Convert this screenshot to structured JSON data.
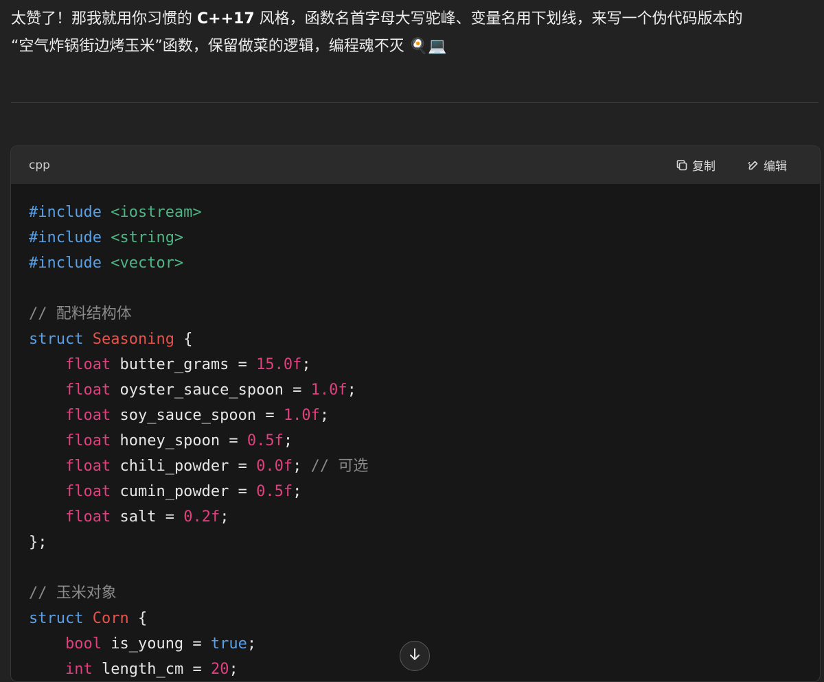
{
  "intro": {
    "line1_pre": "太赞了！那我就用你习惯的 ",
    "line1_bold": "C++17",
    "line1_post": " 风格，函数名首字母大写驼峰、变量名用下划线，来写一个伪代码版本的",
    "line2": "“空气炸锅街边烤玉米”函数，保留做菜的逻辑，编程魂不灭",
    "emoji": "🍳💻"
  },
  "code_block": {
    "language": "cpp",
    "copy_label": "复制",
    "edit_label": "编辑",
    "includes": [
      "<iostream>",
      "<string>",
      "<vector>"
    ],
    "include_kw": "include",
    "comment_seasoning": "// 配料结构体",
    "struct_kw": "struct",
    "struct_seasoning": "Seasoning",
    "seasoning_fields": [
      {
        "type": "float",
        "name": "butter_grams",
        "value": "15.0f"
      },
      {
        "type": "float",
        "name": "oyster_sauce_spoon",
        "value": "1.0f"
      },
      {
        "type": "float",
        "name": "soy_sauce_spoon",
        "value": "1.0f"
      },
      {
        "type": "float",
        "name": "honey_spoon",
        "value": "0.5f"
      },
      {
        "type": "float",
        "name": "chili_powder",
        "value": "0.0f",
        "comment": "// 可选"
      },
      {
        "type": "float",
        "name": "cumin_powder",
        "value": "0.5f"
      },
      {
        "type": "float",
        "name": "salt",
        "value": "0.2f"
      }
    ],
    "comment_corn": "// 玉米对象",
    "struct_corn": "Corn",
    "corn_fields": [
      {
        "type": "bool",
        "name": "is_young",
        "value": "true"
      },
      {
        "type": "int",
        "name": "length_cm",
        "value": "20"
      }
    ]
  },
  "scroll_button": {
    "icon": "arrow-down-icon"
  }
}
